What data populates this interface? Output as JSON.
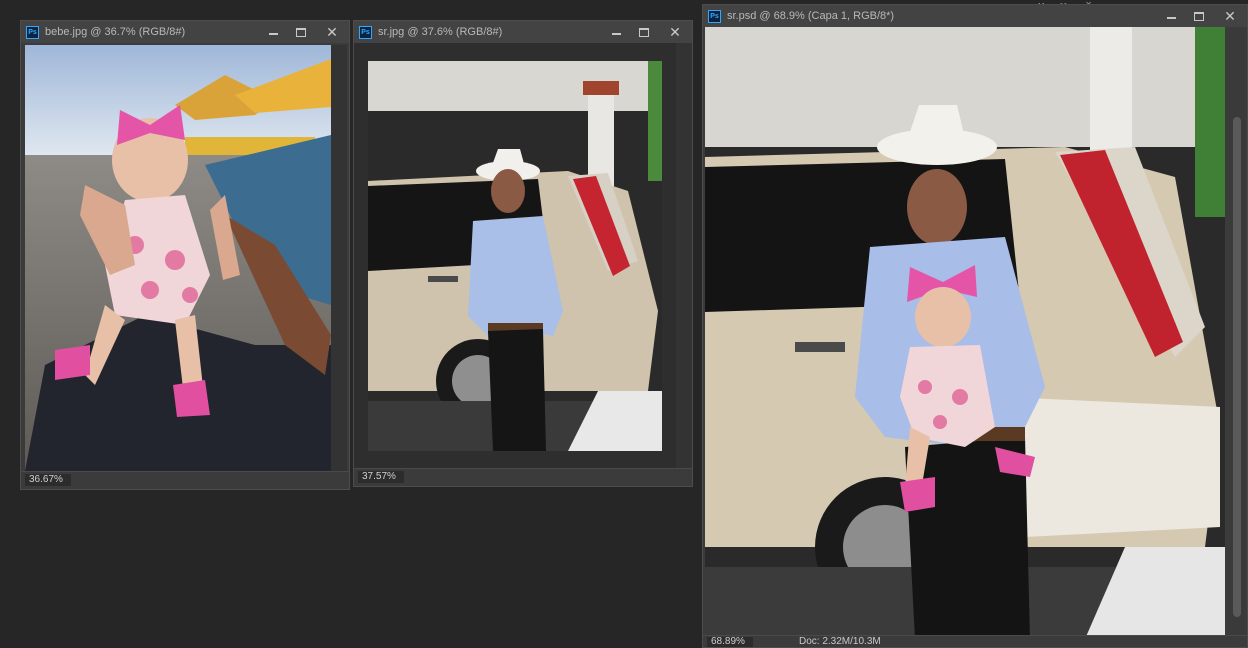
{
  "windows": {
    "bebe": {
      "title": "bebe.jpg @ 36.7% (RGB/8#)",
      "zoom": "36.67%"
    },
    "sr": {
      "title": "sr.jpg @ 37.6% (RGB/8#)",
      "zoom": "37.57%"
    },
    "srpsd": {
      "title": "sr.psd @ 68.9% (Capa 1, RGB/8*)",
      "zoom": "68.89%",
      "doc_info": "Doc: 2.32M/10.3M"
    }
  },
  "icons": {
    "app": "ps-icon",
    "minimize": "minimize-icon",
    "maximize": "maximize-icon",
    "close": "close-icon",
    "rotate_view": "rotate-view-icon"
  },
  "app_icon_text": "Ps",
  "colors": {
    "workspace": "#262626",
    "window_bg": "#3b3b3b",
    "titlebar": "#434343",
    "ps_blue": "#31a8ff"
  }
}
